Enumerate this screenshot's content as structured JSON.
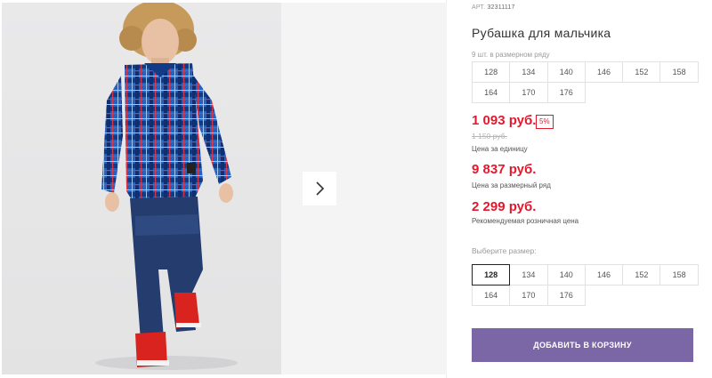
{
  "product": {
    "article_label": "АРТ.",
    "article_number": "32311117",
    "title": "Рубашка для мальчика",
    "pack_note": "9 шт. в размерном ряду",
    "pack_sizes": [
      "128",
      "134",
      "140",
      "146",
      "152",
      "158",
      "164",
      "170",
      "176"
    ]
  },
  "pricing": {
    "unit_price": "1 093 руб.",
    "discount": "5%",
    "old_price": "1 150 руб.",
    "unit_label": "Цена за единицу",
    "pack_price": "9 837 руб.",
    "pack_label": "Цена за размерный ряд",
    "retail_price": "2 299 руб.",
    "retail_label": "Рекомендуемая розничная цена"
  },
  "size_selector": {
    "label": "Выберите размер:",
    "selected": "128",
    "sizes": [
      "128",
      "134",
      "140",
      "146",
      "152",
      "158",
      "164",
      "170",
      "176"
    ]
  },
  "cart": {
    "add_label": "ДОБАВИТЬ В КОРЗИНУ"
  },
  "gallery": {
    "next_icon": "chevron-right-icon"
  },
  "colors": {
    "accent_red": "#e3182d",
    "button_purple": "#7c67a6"
  }
}
